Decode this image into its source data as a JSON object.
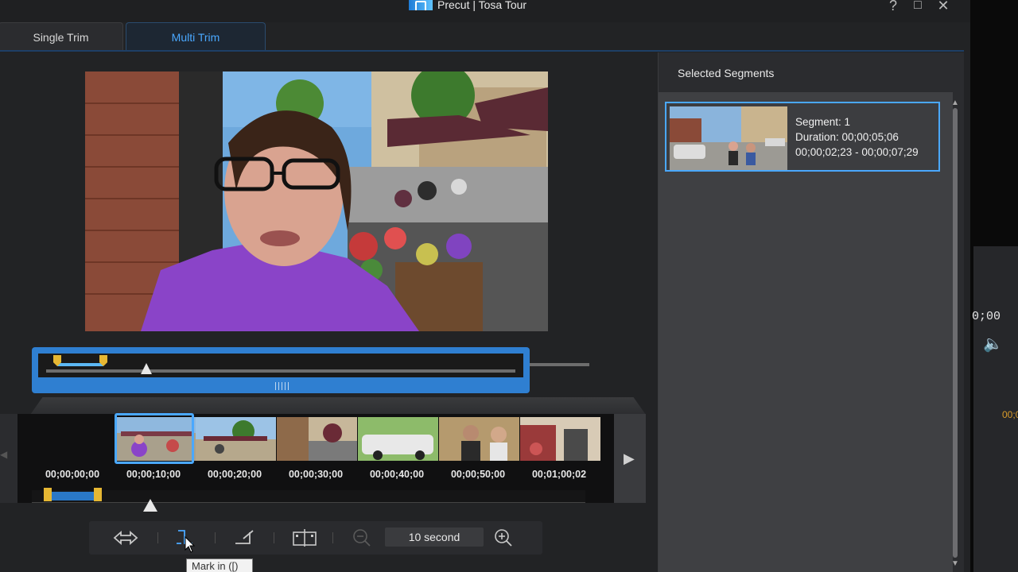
{
  "window": {
    "title": "Precut | Tosa Tour",
    "help_icon": "?",
    "maximize_icon": "□",
    "close_icon": "✕"
  },
  "tabs": [
    {
      "label": "Single Trim",
      "active": false
    },
    {
      "label": "Multi Trim",
      "active": true
    }
  ],
  "timeline": {
    "labels": [
      "00;00;00;00",
      "00;00;10;00",
      "00;00;20;00",
      "00;00;30;00",
      "00;00;40;00",
      "00;00;50;00",
      "00;01;00;02"
    ],
    "next_icon": "▶",
    "prev_icon": "◀"
  },
  "toolbar": {
    "zoom_value": "10 second",
    "tooltip": "Mark in ([)"
  },
  "selected_segments": {
    "title": "Selected Segments",
    "items": [
      {
        "segment_label": "Segment: 1",
        "duration": "Duration: 00;00;05;06",
        "range": "00;00;02;23 - 00;00;07;29"
      }
    ]
  },
  "background_app": {
    "time": "0;00",
    "timecode": "00;0"
  },
  "colors": {
    "accent": "#4aa8ff",
    "trim_bar": "#2f7fd1",
    "handle": "#e6b733"
  }
}
